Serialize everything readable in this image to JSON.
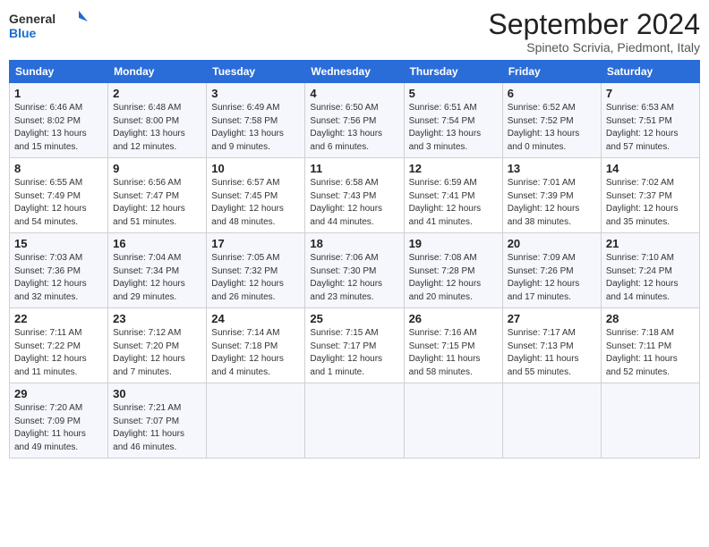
{
  "header": {
    "logo_general": "General",
    "logo_blue": "Blue",
    "title": "September 2024",
    "subtitle": "Spineto Scrivia, Piedmont, Italy"
  },
  "days_of_week": [
    "Sunday",
    "Monday",
    "Tuesday",
    "Wednesday",
    "Thursday",
    "Friday",
    "Saturday"
  ],
  "weeks": [
    [
      {
        "day": "1",
        "sunrise": "6:46 AM",
        "sunset": "8:02 PM",
        "daylight": "13 hours and 15 minutes."
      },
      {
        "day": "2",
        "sunrise": "6:48 AM",
        "sunset": "8:00 PM",
        "daylight": "13 hours and 12 minutes."
      },
      {
        "day": "3",
        "sunrise": "6:49 AM",
        "sunset": "7:58 PM",
        "daylight": "13 hours and 9 minutes."
      },
      {
        "day": "4",
        "sunrise": "6:50 AM",
        "sunset": "7:56 PM",
        "daylight": "13 hours and 6 minutes."
      },
      {
        "day": "5",
        "sunrise": "6:51 AM",
        "sunset": "7:54 PM",
        "daylight": "13 hours and 3 minutes."
      },
      {
        "day": "6",
        "sunrise": "6:52 AM",
        "sunset": "7:52 PM",
        "daylight": "13 hours and 0 minutes."
      },
      {
        "day": "7",
        "sunrise": "6:53 AM",
        "sunset": "7:51 PM",
        "daylight": "12 hours and 57 minutes."
      }
    ],
    [
      {
        "day": "8",
        "sunrise": "6:55 AM",
        "sunset": "7:49 PM",
        "daylight": "12 hours and 54 minutes."
      },
      {
        "day": "9",
        "sunrise": "6:56 AM",
        "sunset": "7:47 PM",
        "daylight": "12 hours and 51 minutes."
      },
      {
        "day": "10",
        "sunrise": "6:57 AM",
        "sunset": "7:45 PM",
        "daylight": "12 hours and 48 minutes."
      },
      {
        "day": "11",
        "sunrise": "6:58 AM",
        "sunset": "7:43 PM",
        "daylight": "12 hours and 44 minutes."
      },
      {
        "day": "12",
        "sunrise": "6:59 AM",
        "sunset": "7:41 PM",
        "daylight": "12 hours and 41 minutes."
      },
      {
        "day": "13",
        "sunrise": "7:01 AM",
        "sunset": "7:39 PM",
        "daylight": "12 hours and 38 minutes."
      },
      {
        "day": "14",
        "sunrise": "7:02 AM",
        "sunset": "7:37 PM",
        "daylight": "12 hours and 35 minutes."
      }
    ],
    [
      {
        "day": "15",
        "sunrise": "7:03 AM",
        "sunset": "7:36 PM",
        "daylight": "12 hours and 32 minutes."
      },
      {
        "day": "16",
        "sunrise": "7:04 AM",
        "sunset": "7:34 PM",
        "daylight": "12 hours and 29 minutes."
      },
      {
        "day": "17",
        "sunrise": "7:05 AM",
        "sunset": "7:32 PM",
        "daylight": "12 hours and 26 minutes."
      },
      {
        "day": "18",
        "sunrise": "7:06 AM",
        "sunset": "7:30 PM",
        "daylight": "12 hours and 23 minutes."
      },
      {
        "day": "19",
        "sunrise": "7:08 AM",
        "sunset": "7:28 PM",
        "daylight": "12 hours and 20 minutes."
      },
      {
        "day": "20",
        "sunrise": "7:09 AM",
        "sunset": "7:26 PM",
        "daylight": "12 hours and 17 minutes."
      },
      {
        "day": "21",
        "sunrise": "7:10 AM",
        "sunset": "7:24 PM",
        "daylight": "12 hours and 14 minutes."
      }
    ],
    [
      {
        "day": "22",
        "sunrise": "7:11 AM",
        "sunset": "7:22 PM",
        "daylight": "12 hours and 11 minutes."
      },
      {
        "day": "23",
        "sunrise": "7:12 AM",
        "sunset": "7:20 PM",
        "daylight": "12 hours and 7 minutes."
      },
      {
        "day": "24",
        "sunrise": "7:14 AM",
        "sunset": "7:18 PM",
        "daylight": "12 hours and 4 minutes."
      },
      {
        "day": "25",
        "sunrise": "7:15 AM",
        "sunset": "7:17 PM",
        "daylight": "12 hours and 1 minute."
      },
      {
        "day": "26",
        "sunrise": "7:16 AM",
        "sunset": "7:15 PM",
        "daylight": "11 hours and 58 minutes."
      },
      {
        "day": "27",
        "sunrise": "7:17 AM",
        "sunset": "7:13 PM",
        "daylight": "11 hours and 55 minutes."
      },
      {
        "day": "28",
        "sunrise": "7:18 AM",
        "sunset": "7:11 PM",
        "daylight": "11 hours and 52 minutes."
      }
    ],
    [
      {
        "day": "29",
        "sunrise": "7:20 AM",
        "sunset": "7:09 PM",
        "daylight": "11 hours and 49 minutes."
      },
      {
        "day": "30",
        "sunrise": "7:21 AM",
        "sunset": "7:07 PM",
        "daylight": "11 hours and 46 minutes."
      },
      null,
      null,
      null,
      null,
      null
    ]
  ]
}
